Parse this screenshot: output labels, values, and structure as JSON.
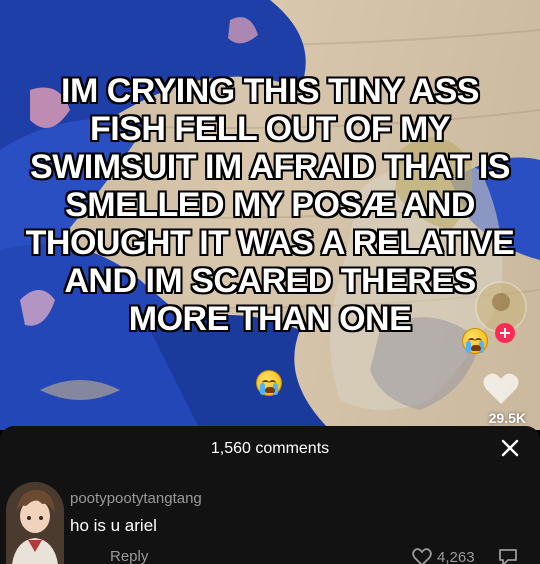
{
  "video": {
    "caption": "IM CRYING THIS TINY ASS FISH FELL OUT OF MY SWIMSUIT IM AFRAID THAT IS SMELLED MY POSÆ AND THOUGHT IT WAS A RELATIVE AND IM SCARED THERES MORE THAN ONE",
    "side_count": "29.5K"
  },
  "comments": {
    "header": "1,560 comments",
    "close_icon": "close-icon",
    "items": [
      {
        "username": "pootypootytangtang",
        "text": "ho is u ariel",
        "reply_label": "Reply",
        "likes": "4,263"
      }
    ]
  }
}
